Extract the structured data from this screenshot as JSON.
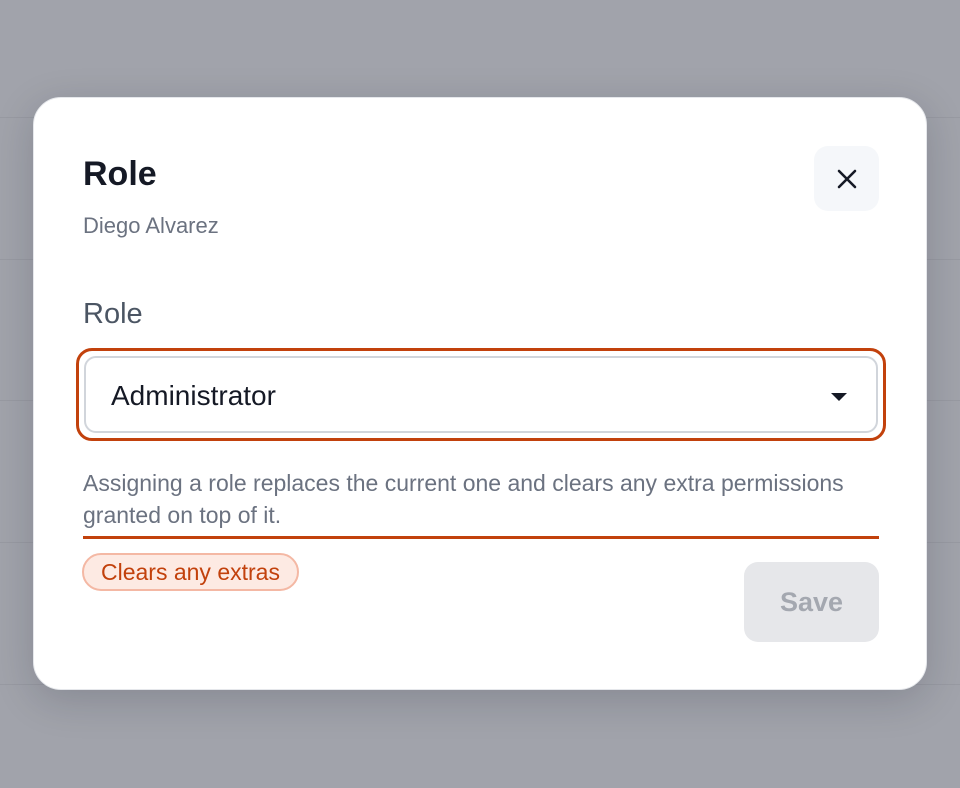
{
  "dialog": {
    "title": "Role",
    "subtitle": "Diego Alvarez",
    "close_icon": "close-icon"
  },
  "role_field": {
    "label": "Role",
    "selected_value": "Administrator",
    "caret_icon": "caret-down-icon",
    "help_text": "Assigning a role replaces the current one and clears any extra permissions granted on top of it.",
    "focus_color": "#c2410c"
  },
  "warning_badge": {
    "label": "Clears any extras",
    "color": "#c2410c"
  },
  "actions": {
    "save_label": "Save",
    "save_disabled": true
  }
}
